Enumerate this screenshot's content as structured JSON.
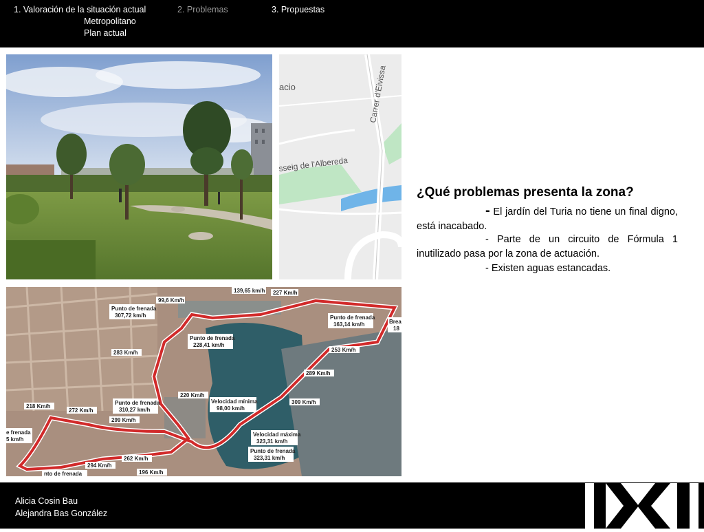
{
  "header": {
    "nav": [
      {
        "label": "1. Valoración de la situación actual"
      },
      {
        "label": "2. Problemas"
      },
      {
        "label": "3. Propuestas"
      }
    ],
    "sub_items": [
      "Metropolitano",
      "Plan actual"
    ]
  },
  "map": {
    "labels": [
      "acio",
      "Carrer d'Eivissa",
      "sseig de l'Albereda"
    ]
  },
  "circuit": {
    "labels": [
      "139,65 km/h",
      "227 Km/h",
      "99,6 Km/h",
      "Punto de frenada",
      "307,72 km/h",
      "Punto de frenada",
      "163,14 km/h",
      "Brea",
      "18",
      "Punto de frenada",
      "228,41 km/h",
      "283 Km/h",
      "253 Km/h",
      "289 Km/h",
      "220 Km/h",
      "Punto de frenada",
      "310,27 km/h",
      "Velocidad mínima",
      "98,00 km/h",
      "309 Km/h",
      "218 Km/h",
      "272 Km/h",
      "299 Km/h",
      "e frenada",
      "5 km/h",
      "Velocidad máxima",
      "323,31 km/h",
      "Punto de frenada",
      "323,31 km/h",
      "262 Km/h",
      "294 Km/h",
      "196 Km/h",
      "nto de frenada"
    ]
  },
  "content": {
    "heading": "¿Qué problemas presenta la zona?",
    "points": [
      {
        "dash": "-",
        "text": " El jardín del Turia no tiene un final digno, está inacabado."
      },
      {
        "dash": "-",
        "text": " Parte de un circuito de Fórmula 1 inutilizado pasa por la zona de actuación."
      },
      {
        "dash": "-",
        "text": " Existen aguas estancadas."
      }
    ]
  },
  "footer": {
    "authors": [
      "Alicia Cosin Bau",
      "Alejandra Bas González"
    ]
  },
  "colors": {
    "bar": "#000000",
    "nav_active": "#ffffff",
    "nav_dim": "#9a9a9a",
    "track": "#d12a2a",
    "water": "#2f5e68",
    "map_water": "#6fb4e8",
    "map_park": "#bfe6c4"
  },
  "icons": {
    "logo": "xi-logo"
  }
}
